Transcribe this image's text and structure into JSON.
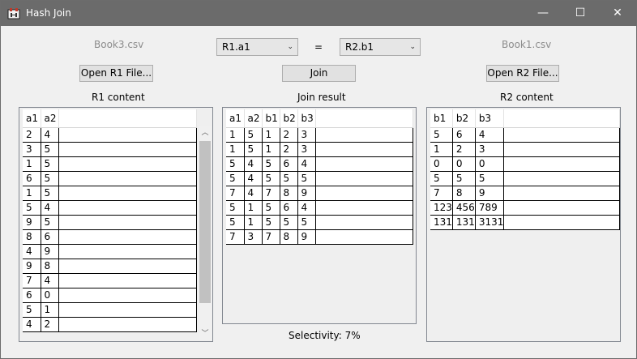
{
  "window": {
    "title": "Hash Join",
    "minimize_glyph": "—",
    "maximize_glyph": "☐",
    "close_glyph": "✕"
  },
  "left": {
    "file_label": "Book3.csv",
    "open_button": "Open R1 File...",
    "content_label": "R1 content",
    "columns": [
      "a1",
      "a2"
    ],
    "rows": [
      [
        "2",
        "4"
      ],
      [
        "3",
        "5"
      ],
      [
        "1",
        "5"
      ],
      [
        "6",
        "5"
      ],
      [
        "1",
        "5"
      ],
      [
        "5",
        "4"
      ],
      [
        "9",
        "5"
      ],
      [
        "8",
        "6"
      ],
      [
        "4",
        "9"
      ],
      [
        "9",
        "8"
      ],
      [
        "7",
        "4"
      ],
      [
        "6",
        "0"
      ],
      [
        "5",
        "1"
      ],
      [
        "4",
        "2"
      ]
    ]
  },
  "middle": {
    "r1_column": "R1.a1",
    "equals": "=",
    "r2_column": "R2.b1",
    "join_button": "Join",
    "content_label": "Join result",
    "columns": [
      "a1",
      "a2",
      "b1",
      "b2",
      "b3"
    ],
    "rows": [
      [
        "1",
        "5",
        "1",
        "2",
        "3"
      ],
      [
        "1",
        "5",
        "1",
        "2",
        "3"
      ],
      [
        "5",
        "4",
        "5",
        "6",
        "4"
      ],
      [
        "5",
        "4",
        "5",
        "5",
        "5"
      ],
      [
        "7",
        "4",
        "7",
        "8",
        "9"
      ],
      [
        "5",
        "1",
        "5",
        "6",
        "4"
      ],
      [
        "5",
        "1",
        "5",
        "5",
        "5"
      ],
      [
        "7",
        "3",
        "7",
        "8",
        "9"
      ]
    ],
    "selectivity": "Selectivity: 7%"
  },
  "right": {
    "file_label": "Book1.csv",
    "open_button": "Open R2 File...",
    "content_label": "R2 content",
    "columns": [
      "b1",
      "b2",
      "b3"
    ],
    "rows": [
      [
        "5",
        "6",
        "4"
      ],
      [
        "1",
        "2",
        "3"
      ],
      [
        "0",
        "0",
        "0"
      ],
      [
        "5",
        "5",
        "5"
      ],
      [
        "7",
        "8",
        "9"
      ],
      [
        "123",
        "456",
        "789"
      ],
      [
        "131",
        "131",
        "3131"
      ]
    ]
  },
  "icons": {
    "app": "hash-join-app-icon",
    "combo_arrow": "chevron-down-icon",
    "scroll_up": "scroll-up-icon",
    "scroll_down": "scroll-down-icon"
  }
}
